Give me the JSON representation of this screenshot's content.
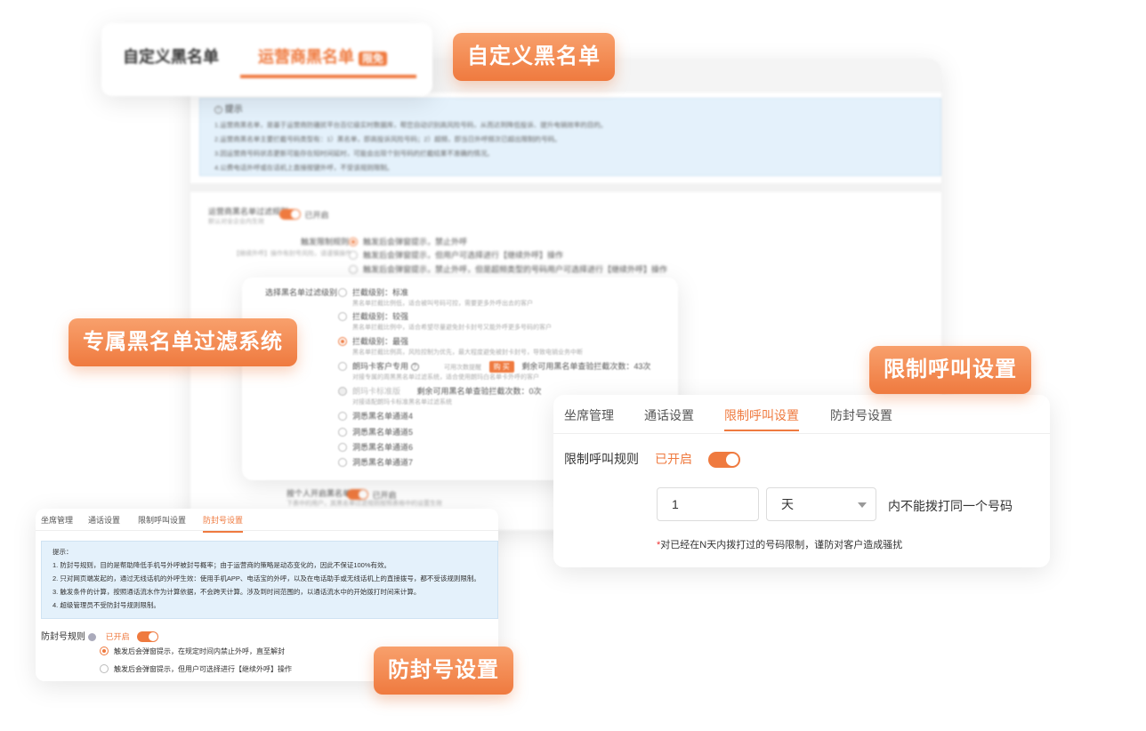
{
  "tags": {
    "custom_blacklist": "自定义黑名单",
    "exclusive_filter": "专属黑名单过滤系统",
    "call_limit": "限制呼叫设置",
    "anti_block": "防封号设置"
  },
  "top_tabs": {
    "custom": "自定义黑名单",
    "carrier": "运营商黑名单",
    "badge": "限免"
  },
  "tip_panel": {
    "title": "提示",
    "lines": [
      "1.运营商黑名单，是基于运营商防骚扰平台百亿级实时数据库，帮您自动识别高风险号码，从而达到降低投诉、提升电销效率的目的。",
      "2.运营商黑名单主要拦截号码类型有：1）黑名单，即高投诉风险号码；2）超频，即当日外呼频次已超出限制的号码。",
      "3.因运营商号码状态更新可能存在短时间延时，可能会出现个别号码的拦截结果不准确的情况。",
      "4.公费电话外呼或在话机上直接按键外呼，不受该规则限制。"
    ]
  },
  "filter_rule": {
    "label": "运营商黑名单过滤规则",
    "sub": "默认对全企业内生效",
    "status": "已开启"
  },
  "trigger": {
    "label": "触发限制规则",
    "note": "【继续外呼】操作有封号风险，请谨慎操作",
    "options": [
      "触发后会弹窗提示，禁止外呼",
      "触发后会弹窗提示，但用户可选择进行【继续外呼】操作",
      "触发后会弹窗提示，禁止外呼，但是超频类型的号码用户可选择进行【继续外呼】操作"
    ]
  },
  "levels": {
    "label": "选择黑名单过滤级别",
    "items": [
      {
        "title": "拦截级别：标准",
        "desc": "黑名单拦截比例低，适合被叫号码可控，需要更多外呼出去的客户"
      },
      {
        "title": "拦截级别：较强",
        "desc": "黑名单拦截比例中，适合希望尽量避免封卡封号又能外呼更多号码的客户"
      },
      {
        "title": "拦截级别：最强",
        "desc": "黑名单拦截比例高，风险控制为优先，最大程度避免被封卡封号，导致电销业务中断"
      }
    ],
    "special": {
      "title": "朗玛卡客户专用",
      "link": "可用次数提醒",
      "buy": "购 买",
      "remain": "剩余可用黑名单查验拦截次数：43次",
      "desc": "对接专属的周黑黑名单过滤系统，适合使用朗玛白名单卡外呼的客户"
    },
    "standard": {
      "title": "朗玛卡标准版",
      "remain": "剩余可用黑名单查验拦截次数：0次",
      "desc": "对接适配朗玛卡标准黑名单过滤系统"
    },
    "channels": [
      "洞悉黑名单通道4",
      "洞悉黑名单通道5",
      "洞悉黑名单通道6",
      "洞悉黑名单通道7"
    ]
  },
  "personal": {
    "label": "按个人开启黑名单",
    "status": "已开启",
    "sub": "下表中的用户，其黑名单过滤规则按照表格中的设置生效"
  },
  "limit_card": {
    "tabs": [
      "坐席管理",
      "通话设置",
      "限制呼叫设置",
      "防封号设置"
    ],
    "active": 2,
    "rule_label": "限制呼叫规则",
    "rule_status": "已开启",
    "number_value": "1",
    "unit_value": "天",
    "suffix": "内不能拨打同一个号码",
    "note_star": "*",
    "note": "对已经在N天内拨打过的号码限制，谨防对客户造成骚扰"
  },
  "anti_card": {
    "tabs": [
      "坐席管理",
      "通话设置",
      "限制呼叫设置",
      "防封号设置"
    ],
    "active": 3,
    "tip_title": "提示：",
    "tips": [
      "1. 防封号规则，目的是帮助降低手机号外呼被封号概率；由于运营商的策略是动态变化的，因此不保证100%有效。",
      "2. 只对网页端发起的，通过无线话机的外呼生效：使用手机APP、电话宝的外呼，以及在电话助手或无线话机上的直接拨号，都不受该规则限制。",
      "3. 触发条件的计算，按照通话流水作为计算依据，不会跨天计算。涉及到时间范围的，以通话流水中的开始拨打时间来计算。",
      "4. 超级管理员不受防封号规则限制。"
    ],
    "rule_label": "防封号规则",
    "rule_status": "已开启",
    "options": [
      "触发后会弹窗提示，在规定时间内禁止外呼，直至解封",
      "触发后会弹窗提示，但用户可选择进行【继续外呼】操作"
    ]
  },
  "colors": {
    "accent": "#ef7a3f",
    "tip_bg": "#e4f1fb"
  }
}
